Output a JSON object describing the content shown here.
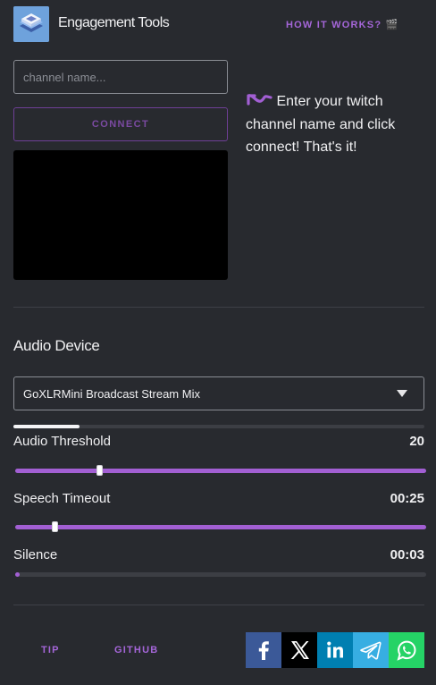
{
  "header": {
    "title": "Engagement Tools",
    "how_link": "HOW IT WORKS? 🎬"
  },
  "channel": {
    "placeholder": "channel name...",
    "value": "",
    "connect_label": "CONNECT"
  },
  "hint": {
    "text": "Enter your twitch channel name and click connect! That's it!"
  },
  "audio": {
    "heading": "Audio Device",
    "device_selected": "GoXLRMini Broadcast Stream Mix",
    "input_level": 0.16
  },
  "settings": {
    "threshold": {
      "label": "Audio Threshold",
      "value": "20",
      "slider_fraction": 0.2
    },
    "speech_timeout": {
      "label": "Speech Timeout",
      "value": "00:25",
      "slider_fraction": 0.09
    },
    "silence": {
      "label": "Silence",
      "value": "00:03",
      "slider_fraction": 0.01
    }
  },
  "footer": {
    "tip_label": "TIP",
    "github_label": "GITHUB"
  },
  "share": [
    {
      "icon": "facebook-icon",
      "color": "#3b5998"
    },
    {
      "icon": "x-icon",
      "color": "#000000"
    },
    {
      "icon": "linkedin-icon",
      "color": "#007fb1"
    },
    {
      "icon": "telegram-icon",
      "color": "#37aee2"
    },
    {
      "icon": "whatsapp-icon",
      "color": "#25d366"
    }
  ],
  "colors": {
    "accent": "#a25fd3",
    "background": "#282a2f"
  }
}
